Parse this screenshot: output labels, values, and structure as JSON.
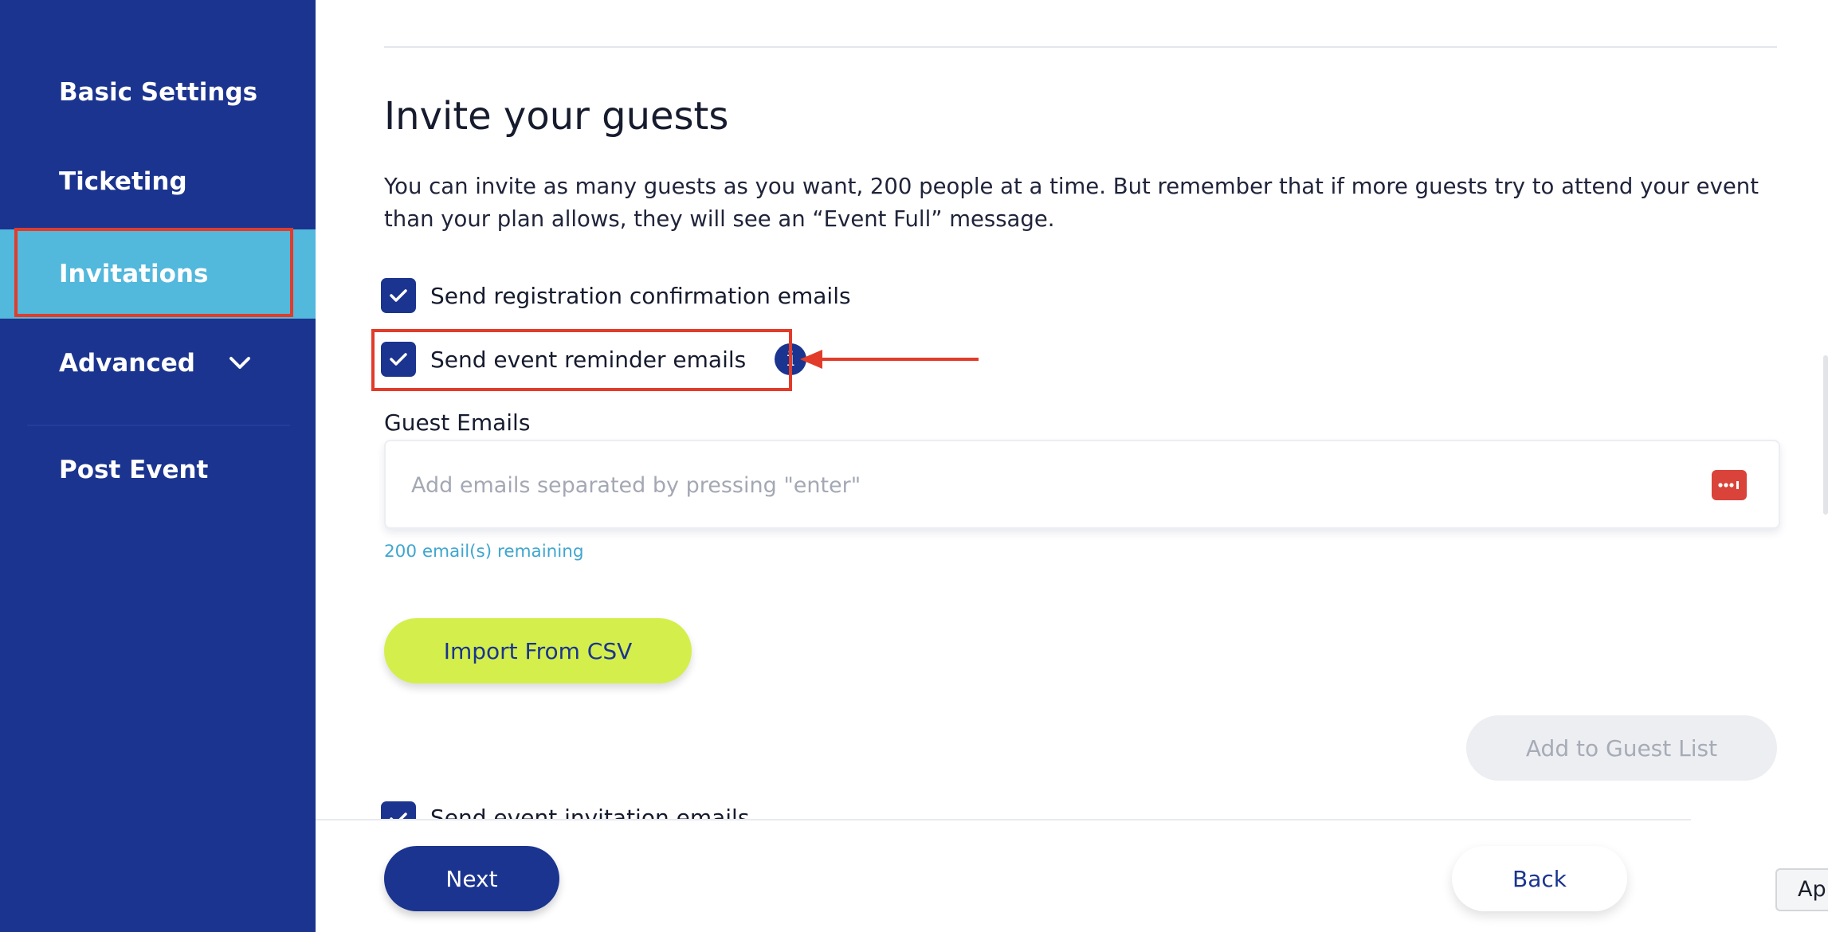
{
  "sidebar": {
    "items": [
      {
        "label": "Basic Settings"
      },
      {
        "label": "Ticketing"
      },
      {
        "label": "Invitations",
        "active": true
      },
      {
        "label": "Advanced",
        "icon": "chevron-down-icon"
      },
      {
        "label": "Post Event"
      }
    ]
  },
  "main": {
    "title": "Invite your guests",
    "description": "You can invite as many guests as you want, 200 people at a time. But remember that if more guests try to attend your event than your plan allows, they will see an “Event Full” message.",
    "options": {
      "registration_confirmation": {
        "label": "Send registration confirmation emails",
        "checked": true
      },
      "event_reminder": {
        "label": "Send event reminder emails",
        "checked": true,
        "icon": "info-icon"
      },
      "event_invitation": {
        "label": "Send event invitation emails",
        "checked": true
      }
    },
    "guest_emails": {
      "label": "Guest Emails",
      "placeholder": "Add emails separated by pressing \"enter\"",
      "value": "",
      "remaining_text": "200 email(s) remaining",
      "icon": "password-manager-icon"
    },
    "import_button": "Import From CSV",
    "add_button": "Add to Guest List"
  },
  "footer": {
    "next_label": "Next",
    "back_label": "Back"
  },
  "edge_tab": {
    "label": "App"
  },
  "colors": {
    "primary": "#1b348f",
    "active_nav": "#52b8dc",
    "accent_lime": "#d4ef4c",
    "annotation": "#e23b2a",
    "link": "#3fa6cf"
  }
}
